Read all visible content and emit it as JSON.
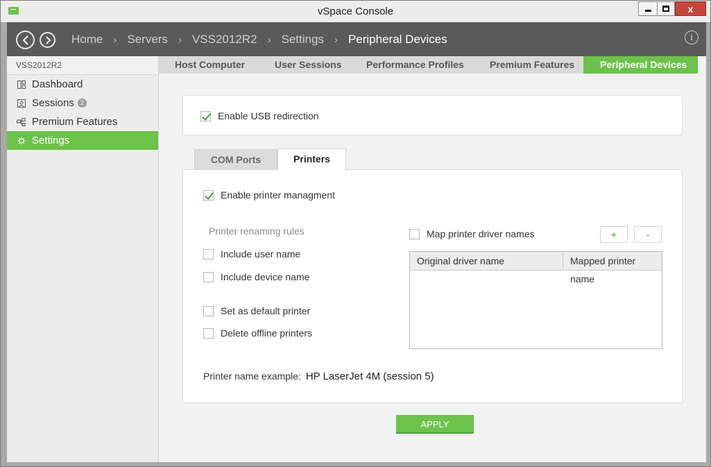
{
  "window": {
    "title": "vSpace Console",
    "close_label": "x"
  },
  "nav": {
    "back_icon": "chevron-left-icon",
    "forward_icon": "chevron-right-icon",
    "breadcrumbs": [
      "Home",
      "Servers",
      "VSS2012R2",
      "Settings",
      "Peripheral Devices"
    ],
    "separator": "›",
    "info_glyph": "i"
  },
  "sidebar": {
    "header": "VSS2012R2",
    "items": [
      {
        "label": "Dashboard",
        "icon": "dashboard-icon",
        "active": false
      },
      {
        "label": "Sessions",
        "icon": "sessions-icon",
        "badge": "2",
        "active": false
      },
      {
        "label": "Premium Features",
        "icon": "premium-features-icon",
        "active": false
      },
      {
        "label": "Settings",
        "icon": "settings-icon",
        "active": true
      }
    ]
  },
  "topnav": {
    "items": [
      "Host Computer",
      "User Sessions",
      "Performance Profiles",
      "Premium Features",
      "Peripheral Devices"
    ],
    "active_index": 4
  },
  "usb": {
    "label": "Enable USB redirection",
    "checked": true
  },
  "tabs": {
    "items": [
      "COM Ports",
      "Printers"
    ],
    "active_index": 1
  },
  "printers": {
    "enable_label": "Enable printer managment",
    "enable_checked": true,
    "renaming_title": "Printer renaming rules",
    "include_user": "Include user name",
    "include_device": "Include device name",
    "set_default": "Set as default printer",
    "delete_offline": "Delete offline printers",
    "map_label": "Map printer driver names",
    "add_label": "+",
    "remove_label": "-",
    "table_headers": [
      "Original driver name",
      "Mapped printer name"
    ],
    "table_rows": [],
    "example_label": "Printer name example:",
    "example_value": "HP LaserJet 4M (session 5)"
  },
  "apply_label": "APPLY",
  "colors": {
    "accent": "#6cc24a",
    "navbar": "#5a5a5a",
    "close": "#c7463a"
  }
}
